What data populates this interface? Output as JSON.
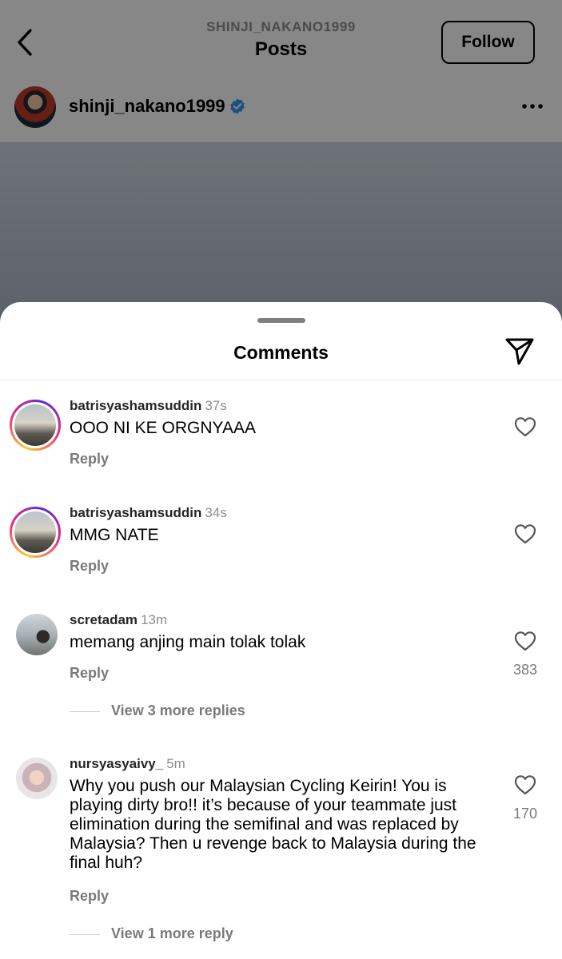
{
  "header": {
    "username_caps": "SHINJI_NAKANO1999",
    "title": "Posts",
    "follow_label": "Follow"
  },
  "post": {
    "author": "shinji_nakano1999",
    "verified": true
  },
  "comments_sheet": {
    "title": "Comments",
    "comments": [
      {
        "user": "batrisyashamsuddin",
        "time": "37s",
        "text": "OOO NI KE ORGNYAAA",
        "reply_label": "Reply"
      },
      {
        "user": "batrisyashamsuddin",
        "time": "34s",
        "text": "MMG NATE",
        "reply_label": "Reply"
      },
      {
        "user": "scretadam",
        "time": "13m",
        "text": "memang anjing main tolak tolak",
        "reply_label": "Reply",
        "likes": "383",
        "view_more": "View 3 more replies"
      },
      {
        "user": "nursyasyaivy_",
        "time": "5m",
        "text": "Why you push our Malaysian Cycling Keirin! You is playing dirty bro!! it’s because of your teammate just elimination during the semifinal and was replaced by Malaysia? Then u revenge back to Malaysia during the final huh?",
        "reply_label": "Reply",
        "likes": "170",
        "view_more": "View 1 more reply"
      }
    ]
  },
  "colors": {
    "verified_blue": "#3897f0",
    "secondary_text": "#8e8e8e"
  }
}
